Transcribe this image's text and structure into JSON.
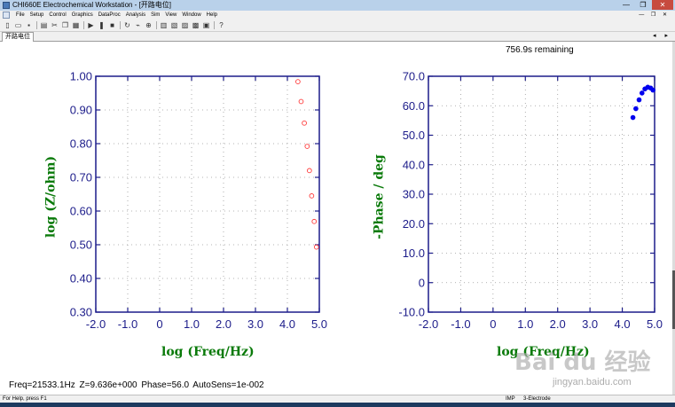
{
  "window": {
    "title": "CHI660E Electrochemical Workstation - [开路电位]",
    "min": "—",
    "max": "❐",
    "close": "✕"
  },
  "menu": {
    "items": [
      "File",
      "Setup",
      "Control",
      "Graphics",
      "DataProc",
      "Analysis",
      "Sim",
      "View",
      "Window",
      "Help"
    ],
    "right_controls": "— ❐ ✕"
  },
  "toolbar": {
    "icons": [
      "new-icon",
      "open-icon",
      "save-icon",
      "print-icon",
      "cut-icon",
      "copy-icon",
      "paste-icon",
      "run-icon",
      "pause-icon",
      "stop-icon",
      "reverse-icon",
      "filter-icon",
      "zoom-icon",
      "graph-icon",
      "overlay-icon",
      "add-icon",
      "parameter-icon",
      "info-icon",
      "help-pointer-icon"
    ]
  },
  "tab": {
    "label": "开路电位",
    "arrows": "◂ ▸"
  },
  "status_text": "756.9s remaining",
  "info_line": "Freq=21533.1Hz  Z=9.636e+000  Phase=56.0  AutoSens=1e-002",
  "statusbar": {
    "help": "For Help, press F1",
    "mode": "IMP",
    "electrode": "3-Electrode"
  },
  "watermark": {
    "logo": "Bai du 经验",
    "url": "jingyan.baidu.com"
  },
  "colors": {
    "axis": "#1c1c8a",
    "label": "#0a7a0a",
    "impedance_marker": "#ff3b3b",
    "phase_marker": "#0000ee"
  },
  "chart_data": [
    {
      "type": "scatter",
      "xlabel": "log (Freq/Hz)",
      "ylabel": "log (Z/ohm)",
      "xlim": [
        -2.0,
        5.0
      ],
      "ylim": [
        0.3,
        1.0
      ],
      "xticks": [
        "-2.0",
        "-1.0",
        "0",
        "1.0",
        "2.0",
        "3.0",
        "4.0",
        "5.0"
      ],
      "yticks": [
        "0.30",
        "0.40",
        "0.50",
        "0.60",
        "0.70",
        "0.80",
        "0.90",
        "1.00"
      ],
      "grid": true,
      "marker": "open-circle",
      "series": [
        {
          "x": [
            4.33,
            4.43,
            4.53,
            4.62,
            4.69,
            4.76,
            4.84,
            4.91
          ],
          "y": [
            0.984,
            0.925,
            0.861,
            0.792,
            0.72,
            0.645,
            0.569,
            0.493
          ]
        }
      ]
    },
    {
      "type": "scatter",
      "xlabel": "log (Freq/Hz)",
      "ylabel": "-Phase / deg",
      "xlim": [
        -2.0,
        5.0
      ],
      "ylim": [
        -10.0,
        70.0
      ],
      "xticks": [
        "-2.0",
        "-1.0",
        "0",
        "1.0",
        "2.0",
        "3.0",
        "4.0",
        "5.0"
      ],
      "yticks": [
        "-10.0",
        "0",
        "10.0",
        "20.0",
        "30.0",
        "40.0",
        "50.0",
        "60.0",
        "70.0"
      ],
      "grid": true,
      "marker": "filled-circle",
      "series": [
        {
          "x": [
            4.33,
            4.42,
            4.52,
            4.61,
            4.7,
            4.79,
            4.88,
            4.95
          ],
          "y": [
            56.0,
            59.0,
            62.0,
            64.3,
            65.7,
            66.3,
            66.0,
            65.3
          ]
        }
      ]
    }
  ]
}
